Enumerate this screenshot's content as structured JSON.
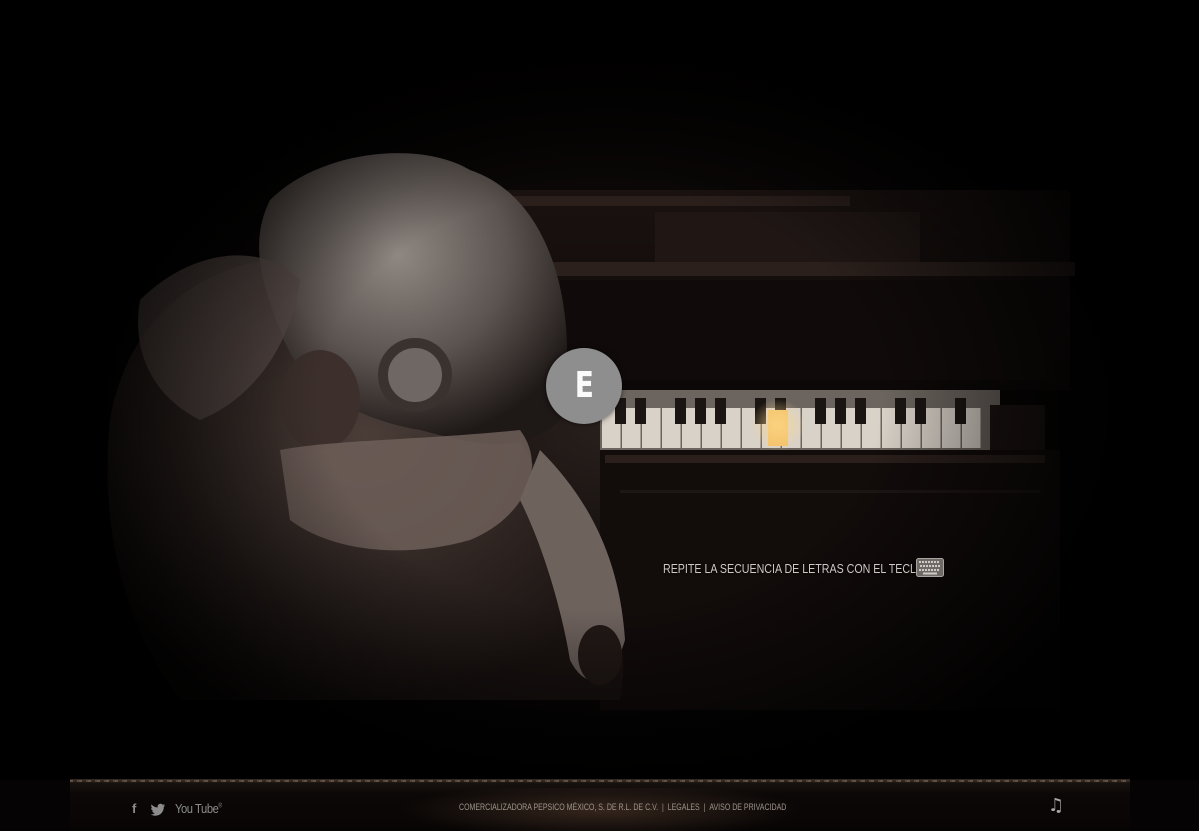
{
  "prompt": {
    "letter": "E"
  },
  "instruction": {
    "text": "REPITE LA SECUENCIA DE LETRAS CON EL TECLADO",
    "icon": "keyboard-icon"
  },
  "footer": {
    "social": {
      "facebook": "f",
      "twitter_icon": "twitter-icon",
      "youtube": "You Tube"
    },
    "company": "COMERCIALIZADORA PEPSICO MÉXICO, S. DE R.L. DE C.V.",
    "legales": "LEGALES",
    "privacy": "AVISO DE PRIVACIDAD",
    "music_icon": "♫"
  },
  "colors": {
    "circle": "#8e8e8e",
    "lit_key": "#f2c26a",
    "text": "#cfc9c4"
  }
}
